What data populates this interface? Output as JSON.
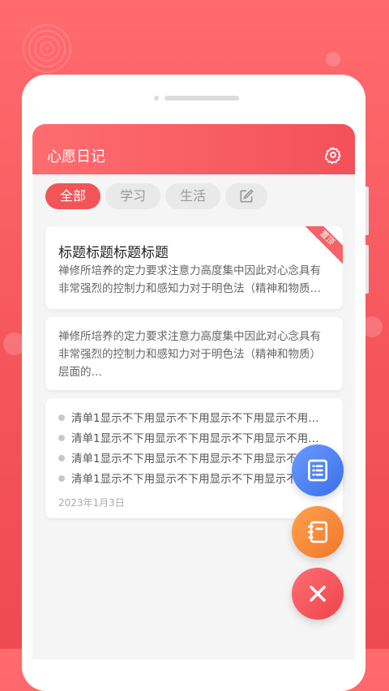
{
  "app": {
    "title": "心愿日记"
  },
  "tabs": [
    {
      "label": "全部",
      "active": true
    },
    {
      "label": "学习",
      "active": false
    },
    {
      "label": "生活",
      "active": false
    },
    {
      "icon": "edit-icon"
    }
  ],
  "cards": {
    "card1": {
      "title": "标题标题标题标题",
      "badge": "置顶",
      "text": "禅修所培养的定力要求注意力高度集中因此对心念具有非常强烈的控制力和感知力对于明色法（精神和物质）层面的…"
    },
    "card2": {
      "text": "禅修所培养的定力要求注意力高度集中因此对心念具有非常强烈的控制力和感知力对于明色法（精神和物质）层面的…"
    },
    "card3": {
      "items": [
        "清单1显示不下用显示不下用显示不下用显示不用…",
        "清单1显示不下用显示不下用显示不下用显示不用…",
        "清单1显示不下用显示不下用显示不下用显示不用…",
        "清单1显示不下用显示不下用显示不下用显示不用…"
      ],
      "date": "2023年1月3日"
    }
  },
  "fab": [
    {
      "icon": "list-icon",
      "color": "#4a7ff0"
    },
    {
      "icon": "notebook-icon",
      "color": "#f7883b"
    },
    {
      "icon": "close-icon",
      "color": "#f24e55"
    }
  ],
  "colors": {
    "accent": "#f25558",
    "background": "#f5f5f5"
  }
}
